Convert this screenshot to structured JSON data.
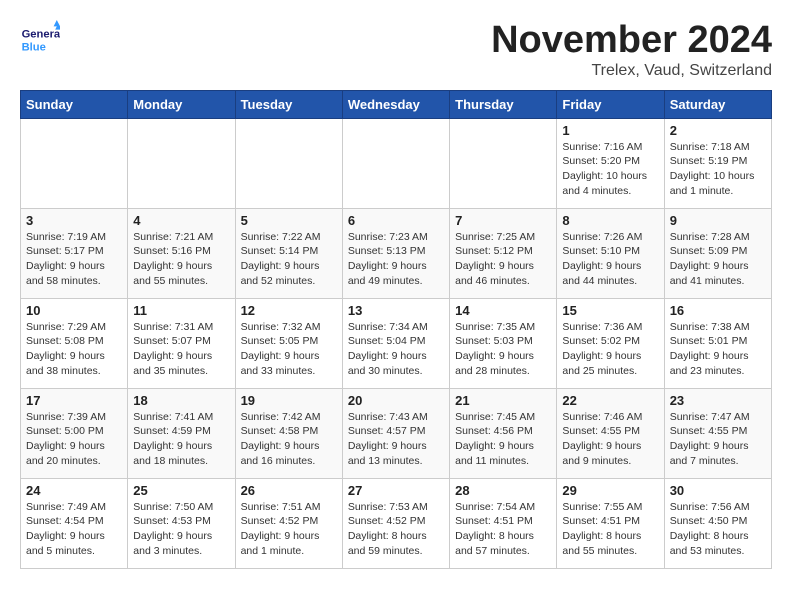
{
  "header": {
    "logo_general": "General",
    "logo_blue": "Blue",
    "month_title": "November 2024",
    "location": "Trelex, Vaud, Switzerland"
  },
  "days_of_week": [
    "Sunday",
    "Monday",
    "Tuesday",
    "Wednesday",
    "Thursday",
    "Friday",
    "Saturday"
  ],
  "weeks": [
    [
      {
        "day": "",
        "info": ""
      },
      {
        "day": "",
        "info": ""
      },
      {
        "day": "",
        "info": ""
      },
      {
        "day": "",
        "info": ""
      },
      {
        "day": "",
        "info": ""
      },
      {
        "day": "1",
        "info": "Sunrise: 7:16 AM\nSunset: 5:20 PM\nDaylight: 10 hours\nand 4 minutes."
      },
      {
        "day": "2",
        "info": "Sunrise: 7:18 AM\nSunset: 5:19 PM\nDaylight: 10 hours\nand 1 minute."
      }
    ],
    [
      {
        "day": "3",
        "info": "Sunrise: 7:19 AM\nSunset: 5:17 PM\nDaylight: 9 hours\nand 58 minutes."
      },
      {
        "day": "4",
        "info": "Sunrise: 7:21 AM\nSunset: 5:16 PM\nDaylight: 9 hours\nand 55 minutes."
      },
      {
        "day": "5",
        "info": "Sunrise: 7:22 AM\nSunset: 5:14 PM\nDaylight: 9 hours\nand 52 minutes."
      },
      {
        "day": "6",
        "info": "Sunrise: 7:23 AM\nSunset: 5:13 PM\nDaylight: 9 hours\nand 49 minutes."
      },
      {
        "day": "7",
        "info": "Sunrise: 7:25 AM\nSunset: 5:12 PM\nDaylight: 9 hours\nand 46 minutes."
      },
      {
        "day": "8",
        "info": "Sunrise: 7:26 AM\nSunset: 5:10 PM\nDaylight: 9 hours\nand 44 minutes."
      },
      {
        "day": "9",
        "info": "Sunrise: 7:28 AM\nSunset: 5:09 PM\nDaylight: 9 hours\nand 41 minutes."
      }
    ],
    [
      {
        "day": "10",
        "info": "Sunrise: 7:29 AM\nSunset: 5:08 PM\nDaylight: 9 hours\nand 38 minutes."
      },
      {
        "day": "11",
        "info": "Sunrise: 7:31 AM\nSunset: 5:07 PM\nDaylight: 9 hours\nand 35 minutes."
      },
      {
        "day": "12",
        "info": "Sunrise: 7:32 AM\nSunset: 5:05 PM\nDaylight: 9 hours\nand 33 minutes."
      },
      {
        "day": "13",
        "info": "Sunrise: 7:34 AM\nSunset: 5:04 PM\nDaylight: 9 hours\nand 30 minutes."
      },
      {
        "day": "14",
        "info": "Sunrise: 7:35 AM\nSunset: 5:03 PM\nDaylight: 9 hours\nand 28 minutes."
      },
      {
        "day": "15",
        "info": "Sunrise: 7:36 AM\nSunset: 5:02 PM\nDaylight: 9 hours\nand 25 minutes."
      },
      {
        "day": "16",
        "info": "Sunrise: 7:38 AM\nSunset: 5:01 PM\nDaylight: 9 hours\nand 23 minutes."
      }
    ],
    [
      {
        "day": "17",
        "info": "Sunrise: 7:39 AM\nSunset: 5:00 PM\nDaylight: 9 hours\nand 20 minutes."
      },
      {
        "day": "18",
        "info": "Sunrise: 7:41 AM\nSunset: 4:59 PM\nDaylight: 9 hours\nand 18 minutes."
      },
      {
        "day": "19",
        "info": "Sunrise: 7:42 AM\nSunset: 4:58 PM\nDaylight: 9 hours\nand 16 minutes."
      },
      {
        "day": "20",
        "info": "Sunrise: 7:43 AM\nSunset: 4:57 PM\nDaylight: 9 hours\nand 13 minutes."
      },
      {
        "day": "21",
        "info": "Sunrise: 7:45 AM\nSunset: 4:56 PM\nDaylight: 9 hours\nand 11 minutes."
      },
      {
        "day": "22",
        "info": "Sunrise: 7:46 AM\nSunset: 4:55 PM\nDaylight: 9 hours\nand 9 minutes."
      },
      {
        "day": "23",
        "info": "Sunrise: 7:47 AM\nSunset: 4:55 PM\nDaylight: 9 hours\nand 7 minutes."
      }
    ],
    [
      {
        "day": "24",
        "info": "Sunrise: 7:49 AM\nSunset: 4:54 PM\nDaylight: 9 hours\nand 5 minutes."
      },
      {
        "day": "25",
        "info": "Sunrise: 7:50 AM\nSunset: 4:53 PM\nDaylight: 9 hours\nand 3 minutes."
      },
      {
        "day": "26",
        "info": "Sunrise: 7:51 AM\nSunset: 4:52 PM\nDaylight: 9 hours\nand 1 minute."
      },
      {
        "day": "27",
        "info": "Sunrise: 7:53 AM\nSunset: 4:52 PM\nDaylight: 8 hours\nand 59 minutes."
      },
      {
        "day": "28",
        "info": "Sunrise: 7:54 AM\nSunset: 4:51 PM\nDaylight: 8 hours\nand 57 minutes."
      },
      {
        "day": "29",
        "info": "Sunrise: 7:55 AM\nSunset: 4:51 PM\nDaylight: 8 hours\nand 55 minutes."
      },
      {
        "day": "30",
        "info": "Sunrise: 7:56 AM\nSunset: 4:50 PM\nDaylight: 8 hours\nand 53 minutes."
      }
    ]
  ]
}
